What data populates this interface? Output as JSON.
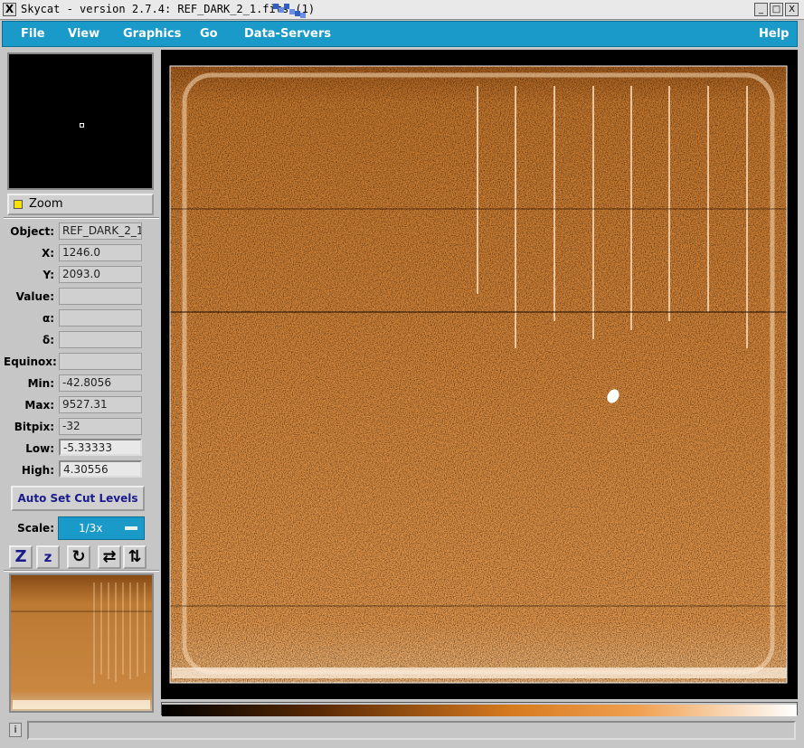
{
  "window": {
    "title": "Skycat - version 2.7.4: REF_DARK_2_1.fits (1)",
    "close_glyph": "X",
    "minimize_glyph": "_",
    "maximize_glyph": "□",
    "close_btn_glyph": "X"
  },
  "menu": {
    "file": "File",
    "view": "View",
    "graphics": "Graphics",
    "go": "Go",
    "data_servers": "Data-Servers",
    "help": "Help"
  },
  "zoom": {
    "label": "Zoom"
  },
  "info": {
    "object": {
      "label": "Object:",
      "value": "REF_DARK_2_1"
    },
    "x": {
      "label": "X:",
      "value": "1246.0"
    },
    "y": {
      "label": "Y:",
      "value": "2093.0"
    },
    "value": {
      "label": "Value:",
      "value": ""
    },
    "alpha": {
      "label": "α:",
      "value": ""
    },
    "delta": {
      "label": "δ:",
      "value": ""
    },
    "equinox": {
      "label": "Equinox:",
      "value": ""
    },
    "min": {
      "label": "Min:",
      "value": "-42.8056"
    },
    "max": {
      "label": "Max:",
      "value": "9527.31"
    },
    "bitpix": {
      "label": "Bitpix:",
      "value": "-32"
    },
    "low": {
      "label": "Low:",
      "value": "-5.33333"
    },
    "high": {
      "label": "High:",
      "value": "4.30556"
    }
  },
  "auto_cut": {
    "label": "Auto Set Cut Levels"
  },
  "scale": {
    "label": "Scale:",
    "value": "1/3x"
  },
  "tools": {
    "zoom_in": "Z",
    "zoom_out": "z",
    "rotate": "↻",
    "flip_x": "⇄",
    "flip_y": "⇅"
  },
  "status": {
    "info_icon_glyph": "i",
    "text": ""
  },
  "colors": {
    "menu_blue": "#1a9ac8",
    "image_orange": "#d9842e",
    "image_dark": "#2a1406"
  }
}
